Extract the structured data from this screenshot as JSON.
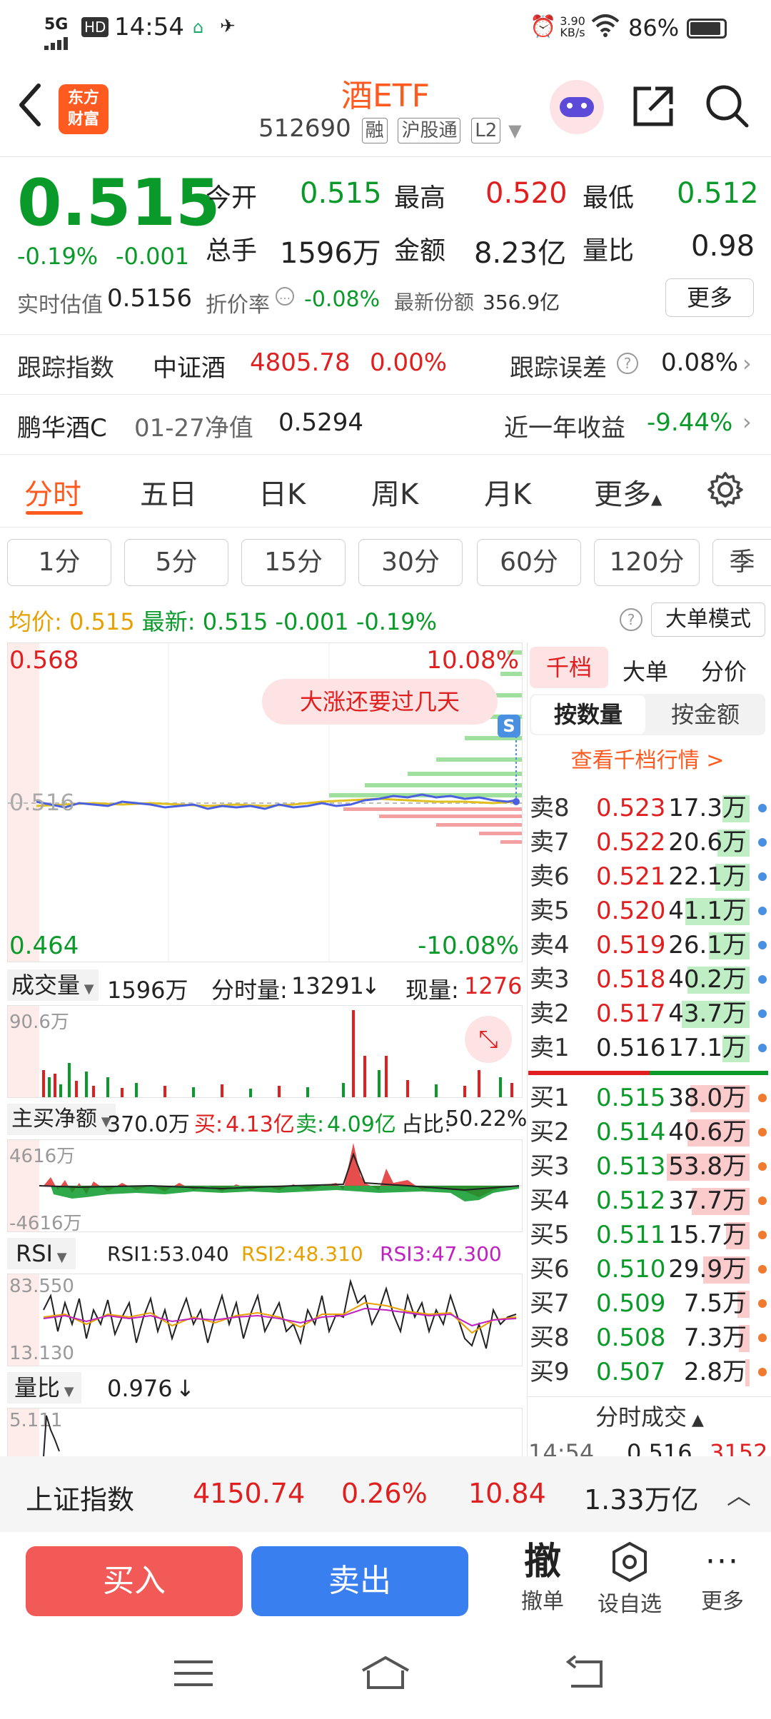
{
  "status": {
    "time": "14:54",
    "network": "5G",
    "hd": "HD",
    "speed": "3.90 KB/s",
    "battery": "86%"
  },
  "header": {
    "title": "酒ETF",
    "code": "512690",
    "tags": [
      "融",
      "沪股通",
      "L2"
    ],
    "logo_text_1": "东方",
    "logo_text_2": "财富"
  },
  "quote": {
    "price": "0.515",
    "change_pct": "-0.19%",
    "change": "-0.001",
    "open_label": "今开",
    "open": "0.515",
    "high_label": "最高",
    "high": "0.520",
    "low_label": "最低",
    "low": "0.512",
    "volume_label": "总手",
    "volume": "1596万",
    "amount_label": "金额",
    "amount": "8.23亿",
    "ratio_label": "量比",
    "ratio": "0.98",
    "est_label": "实时估值",
    "est": "0.5156",
    "discount_label": "折价率",
    "discount": "-0.08%",
    "shares_label": "最新份额",
    "shares": "356.9亿",
    "more": "更多"
  },
  "tracking": {
    "label": "跟踪指数",
    "index_name": "中证酒",
    "index_value": "4805.78",
    "index_pct": "0.00%",
    "error_label": "跟踪误差",
    "error": "0.08%"
  },
  "fund": {
    "name": "鹏华酒C",
    "nav_label": "01-27净值",
    "nav": "0.5294",
    "return_label": "近一年收益",
    "return": "-9.44%"
  },
  "tabs": [
    "分时",
    "五日",
    "日K",
    "周K",
    "月K",
    "更多"
  ],
  "chips": [
    "1分",
    "5分",
    "15分",
    "30分",
    "60分",
    "120分",
    "季"
  ],
  "avgline": {
    "avg_label": "均价:",
    "avg": "0.515",
    "latest_label": "最新:",
    "latest": "0.515",
    "chg": "-0.001",
    "pct": "-0.19%",
    "mode": "大单模式"
  },
  "chart": {
    "top_price": "0.568",
    "top_pct": "10.08%",
    "mid_price": "0.516",
    "bot_price": "0.464",
    "bot_pct": "-10.08%",
    "promo": "大涨还要过几天",
    "s_badge": "S"
  },
  "volume_panel": {
    "label": "成交量",
    "total": "1596万",
    "tick_label": "分时量:",
    "tick": "13291",
    "now_label": "现量:",
    "now": "1276",
    "axis_top": "90.6万"
  },
  "netbuy_panel": {
    "label": "主买净额",
    "value": "370.0万",
    "buy_label": "买:",
    "buy": "4.13亿",
    "sell_label": "卖:",
    "sell": "4.09亿",
    "ratio_label": "占比:",
    "ratio": "50.22%",
    "axis_top": "4616万",
    "axis_bot": "-4616万"
  },
  "rsi_panel": {
    "label": "RSI",
    "rsi1": "RSI1:53.040",
    "rsi2": "RSI2:48.310",
    "rsi3": "RSI3:47.300",
    "axis_top": "83.550",
    "axis_bot": "13.130"
  },
  "ratio_panel": {
    "label": "量比",
    "value": "0.976",
    "axis_top": "5.111"
  },
  "orderbook": {
    "tabs": [
      "千档",
      "大单",
      "分价"
    ],
    "subtabs": [
      "按数量",
      "按金额"
    ],
    "link": "查看千档行情 >",
    "sell": [
      {
        "label": "卖8",
        "price": "0.523",
        "vol": "17.3万",
        "bar": 0.25
      },
      {
        "label": "卖7",
        "price": "0.522",
        "vol": "20.6万",
        "bar": 0.3
      },
      {
        "label": "卖6",
        "price": "0.521",
        "vol": "22.1万",
        "bar": 0.32
      },
      {
        "label": "卖5",
        "price": "0.520",
        "vol": "41.1万",
        "bar": 0.6
      },
      {
        "label": "卖4",
        "price": "0.519",
        "vol": "26.1万",
        "bar": 0.38
      },
      {
        "label": "卖3",
        "price": "0.518",
        "vol": "40.2万",
        "bar": 0.58
      },
      {
        "label": "卖2",
        "price": "0.517",
        "vol": "43.7万",
        "bar": 0.63
      },
      {
        "label": "卖1",
        "price": "0.516",
        "vol": "17.1万",
        "bar": 0.25
      }
    ],
    "buy": [
      {
        "label": "买1",
        "price": "0.515",
        "vol": "38.0万",
        "bar": 0.55
      },
      {
        "label": "买2",
        "price": "0.514",
        "vol": "40.6万",
        "bar": 0.58
      },
      {
        "label": "买3",
        "price": "0.513",
        "vol": "53.8万",
        "bar": 0.77
      },
      {
        "label": "买4",
        "price": "0.512",
        "vol": "37.7万",
        "bar": 0.54
      },
      {
        "label": "买5",
        "price": "0.511",
        "vol": "15.7万",
        "bar": 0.22
      },
      {
        "label": "买6",
        "price": "0.510",
        "vol": "29.9万",
        "bar": 0.43
      },
      {
        "label": "买7",
        "price": "0.509",
        "vol": "7.5万",
        "bar": 0.11
      },
      {
        "label": "买8",
        "price": "0.508",
        "vol": "7.3万",
        "bar": 0.1
      },
      {
        "label": "买9",
        "price": "0.507",
        "vol": "2.8万",
        "bar": 0.04
      }
    ],
    "trades_label": "分时成交",
    "trade_time": "14:54",
    "trade_price": "0.516",
    "trade_vol": "3152"
  },
  "ticker": {
    "name": "上证指数",
    "value": "4150.74",
    "pct": "0.26%",
    "chg": "10.84",
    "amount": "1.33万亿"
  },
  "actions": {
    "buy": "买入",
    "sell": "卖出",
    "cancel_glyph": "撤",
    "cancel": "撤单",
    "watch": "设自选",
    "more": "更多"
  },
  "colors": {
    "up": "#e02020",
    "down": "#0a9a2a",
    "accent": "#ff5a1f",
    "buy_btn": "#f25a57",
    "sell_btn": "#3a7ff0"
  }
}
